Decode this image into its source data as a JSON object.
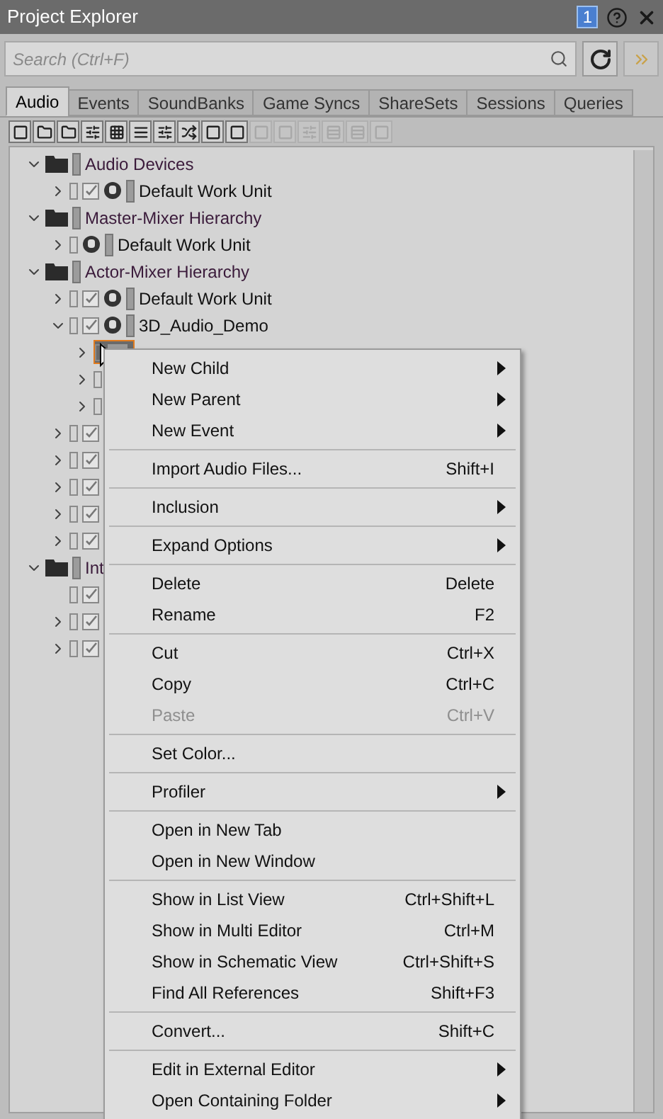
{
  "window": {
    "title": "Project Explorer",
    "badge": "1"
  },
  "search": {
    "placeholder": "Search (Ctrl+F)"
  },
  "tabs": [
    {
      "label": "Audio",
      "selected": true
    },
    {
      "label": "Events",
      "selected": false
    },
    {
      "label": "SoundBanks",
      "selected": false
    },
    {
      "label": "Game Syncs",
      "selected": false
    },
    {
      "label": "ShareSets",
      "selected": false
    },
    {
      "label": "Sessions",
      "selected": false
    },
    {
      "label": "Queries",
      "selected": false
    }
  ],
  "toolbar": [
    {
      "disabled": false
    },
    {
      "disabled": false
    },
    {
      "disabled": false
    },
    {
      "disabled": false
    },
    {
      "disabled": false
    },
    {
      "disabled": false
    },
    {
      "disabled": false
    },
    {
      "disabled": false
    },
    {
      "disabled": false
    },
    {
      "disabled": false
    },
    {
      "disabled": true
    },
    {
      "disabled": true
    },
    {
      "disabled": true
    },
    {
      "disabled": true
    },
    {
      "disabled": true
    },
    {
      "disabled": true
    }
  ],
  "tree": [
    {
      "kind": "folder",
      "label": "Audio Devices",
      "expanded": true,
      "children": [
        {
          "kind": "workunit",
          "label": "Default Work Unit",
          "expanded": false,
          "checked": true
        }
      ]
    },
    {
      "kind": "folder",
      "label": "Master-Mixer Hierarchy",
      "expanded": true,
      "children": [
        {
          "kind": "workunit",
          "label": "Default Work Unit",
          "expanded": false
        }
      ]
    },
    {
      "kind": "folder",
      "label": "Actor-Mixer Hierarchy",
      "expanded": true,
      "children": [
        {
          "kind": "workunit",
          "label": "Default Work Unit",
          "expanded": false,
          "checked": true
        },
        {
          "kind": "workunit",
          "label": "3D_Audio_Demo",
          "expanded": true,
          "checked": true,
          "children": [
            {
              "kind": "object",
              "expanded": false,
              "selected": true
            },
            {
              "kind": "object",
              "expanded": false
            },
            {
              "kind": "object",
              "expanded": false
            }
          ]
        },
        {
          "kind": "object",
          "expanded": false,
          "checked": true
        },
        {
          "kind": "object",
          "expanded": false,
          "checked": true
        },
        {
          "kind": "object",
          "expanded": false,
          "checked": true
        },
        {
          "kind": "object",
          "expanded": false,
          "checked": true
        },
        {
          "kind": "object",
          "expanded": false,
          "checked": true
        }
      ]
    },
    {
      "kind": "folder",
      "label": "Int",
      "expanded": true,
      "children": [
        {
          "kind": "object",
          "checked": true
        },
        {
          "kind": "object",
          "expanded": false,
          "checked": true
        },
        {
          "kind": "object",
          "expanded": false,
          "checked": true
        }
      ]
    }
  ],
  "context_menu": {
    "groups": [
      [
        {
          "label": "New Child",
          "submenu": true,
          "disabled": false
        },
        {
          "label": "New Parent",
          "submenu": true,
          "disabled": false
        },
        {
          "label": "New Event",
          "submenu": true,
          "disabled": false
        }
      ],
      [
        {
          "label": "Import Audio Files...",
          "shortcut": "Shift+I",
          "disabled": false
        }
      ],
      [
        {
          "label": "Inclusion",
          "submenu": true,
          "disabled": false
        }
      ],
      [
        {
          "label": "Expand Options",
          "submenu": true,
          "disabled": false
        }
      ],
      [
        {
          "label": "Delete",
          "shortcut": "Delete",
          "disabled": false
        },
        {
          "label": "Rename",
          "shortcut": "F2",
          "disabled": false
        }
      ],
      [
        {
          "label": "Cut",
          "shortcut": "Ctrl+X",
          "disabled": false
        },
        {
          "label": "Copy",
          "shortcut": "Ctrl+C",
          "disabled": false
        },
        {
          "label": "Paste",
          "shortcut": "Ctrl+V",
          "disabled": true
        }
      ],
      [
        {
          "label": "Set Color...",
          "disabled": false
        }
      ],
      [
        {
          "label": "Profiler",
          "submenu": true,
          "disabled": false
        }
      ],
      [
        {
          "label": "Open in New Tab",
          "disabled": false
        },
        {
          "label": "Open in New Window",
          "disabled": false
        }
      ],
      [
        {
          "label": "Show in List View",
          "shortcut": "Ctrl+Shift+L",
          "disabled": false
        },
        {
          "label": "Show in Multi Editor",
          "shortcut": "Ctrl+M",
          "disabled": false
        },
        {
          "label": "Show in Schematic View",
          "shortcut": "Ctrl+Shift+S",
          "disabled": false
        },
        {
          "label": "Find All References",
          "shortcut": "Shift+F3",
          "disabled": false
        }
      ],
      [
        {
          "label": "Convert...",
          "shortcut": "Shift+C",
          "disabled": false
        }
      ],
      [
        {
          "label": "Edit in External Editor",
          "submenu": true,
          "disabled": false
        },
        {
          "label": "Open Containing Folder",
          "submenu": true,
          "disabled": false
        }
      ]
    ]
  }
}
